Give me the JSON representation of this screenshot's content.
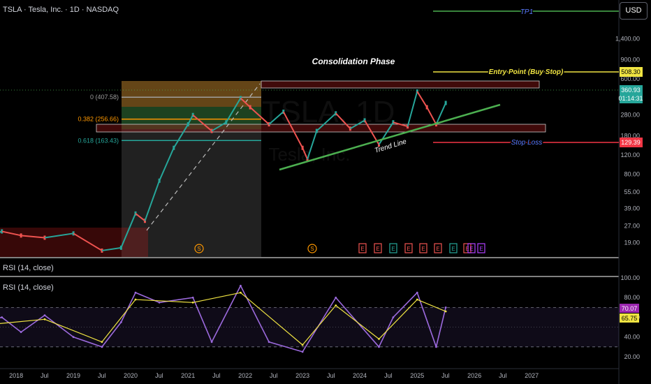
{
  "header": {
    "symbol_line": "TSLA · Tesla, Inc. · 1D · NASDAQ",
    "currency_button": "USD"
  },
  "watermark": {
    "ticker": "TSLA, 1D",
    "name": "Tesla, Inc."
  },
  "panes": {
    "rsi_label_top": "RSI (14, close)",
    "rsi_label": "RSI (14, close)"
  },
  "colors": {
    "background": "#000000",
    "candle_up": "#26a69a",
    "candle_down": "#ef5350",
    "entry_line": "#f0e442",
    "stop_line": "#f23645",
    "tp_line": "#4caf50",
    "trend_line": "#4caf50",
    "fib_0382": "#ff9800",
    "rsi_line": "#9c6ade",
    "rsi_signal": "#f0e442"
  },
  "chart_data": [
    {
      "type": "line",
      "title": "",
      "xlabel": "",
      "ylabel": "",
      "y_scale": "log",
      "ylim": [
        14,
        2100
      ],
      "x_tick_labels": [
        "Jul",
        "2018",
        "Jul",
        "2019",
        "Jul",
        "2020",
        "Jul",
        "2021",
        "Jul",
        "2022",
        "Jul",
        "2023",
        "Jul",
        "2024",
        "Jul",
        "2025",
        "Jul",
        "2026",
        "Jul",
        "2027"
      ],
      "y_tick_labels": [
        "1,400.00",
        "900.00",
        "600.00",
        "400.00",
        "280.00",
        "180.00",
        "120.00",
        "80.00",
        "55.00",
        "39.00",
        "27.00",
        "19.00"
      ],
      "series": [
        {
          "x": [
            "2017-05",
            "2017-09",
            "2018-01",
            "2018-06",
            "2018-12",
            "2019-06",
            "2019-10",
            "2020-01",
            "2020-03",
            "2020-06",
            "2020-09",
            "2020-12",
            "2021-01",
            "2021-05",
            "2021-08",
            "2021-11",
            "2022-01",
            "2022-05",
            "2022-08",
            "2022-12",
            "2023-01",
            "2023-03",
            "2023-07",
            "2023-10",
            "2024-01",
            "2024-04",
            "2024-07",
            "2024-10",
            "2024-12",
            "2025-02",
            "2025-04",
            "2025-06"
          ],
          "values": [
            21,
            24,
            22,
            21,
            23,
            16,
            17,
            35,
            30,
            70,
            140,
            230,
            280,
            200,
            240,
            400,
            330,
            230,
            300,
            140,
            110,
            200,
            290,
            210,
            250,
            150,
            240,
            220,
            460,
            330,
            230,
            361
          ]
        }
      ],
      "annotations": [
        {
          "label": "Consolidation Phase"
        },
        {
          "label": "Entry Point (Buy Stop)",
          "value": 508.3,
          "price_tag": "508.30"
        },
        {
          "label": "Stop Loss",
          "value": 129.39,
          "price_tag": "129.39"
        },
        {
          "label": "TP1"
        },
        {
          "label": "Trend Line"
        },
        {
          "label": "0 (407.58)",
          "value": 407.58
        },
        {
          "label": "0.382 (256.66)",
          "value": 256.66
        },
        {
          "label": "0.618 (163.43)",
          "value": 163.43
        }
      ],
      "last_price": {
        "value": "360.93",
        "countdown": "01:14:31"
      },
      "event_markers": [
        "S",
        "S",
        "E",
        "E",
        "E",
        "E",
        "E",
        "E",
        "E",
        "E",
        "E",
        "E"
      ]
    },
    {
      "type": "line",
      "title": "RSI (14, close)",
      "ylim": [
        15,
        100
      ],
      "y_tick_labels": [
        "100.00",
        "80.00",
        "60.00",
        "40.00",
        "20.00"
      ],
      "levels": [
        70,
        30
      ],
      "series": [
        {
          "name": "RSI",
          "x": [
            "2017-05",
            "2017-09",
            "2018-01",
            "2018-06",
            "2018-12",
            "2019-06",
            "2019-10",
            "2020-01",
            "2020-06",
            "2021-01",
            "2021-05",
            "2021-11",
            "2022-05",
            "2022-12",
            "2023-07",
            "2024-04",
            "2024-07",
            "2024-12",
            "2025-04",
            "2025-06"
          ],
          "values": [
            55,
            60,
            45,
            62,
            40,
            30,
            55,
            85,
            75,
            80,
            35,
            92,
            35,
            25,
            80,
            30,
            60,
            85,
            30,
            70
          ]
        },
        {
          "name": "Signal",
          "x": [
            "2017-05",
            "2018-06",
            "2019-06",
            "2020-01",
            "2021-01",
            "2021-11",
            "2022-12",
            "2023-07",
            "2024-04",
            "2024-12",
            "2025-06"
          ],
          "values": [
            52,
            58,
            35,
            78,
            75,
            85,
            32,
            72,
            38,
            78,
            66
          ]
        }
      ],
      "value_tags": [
        "70.07",
        "65.75"
      ]
    }
  ]
}
